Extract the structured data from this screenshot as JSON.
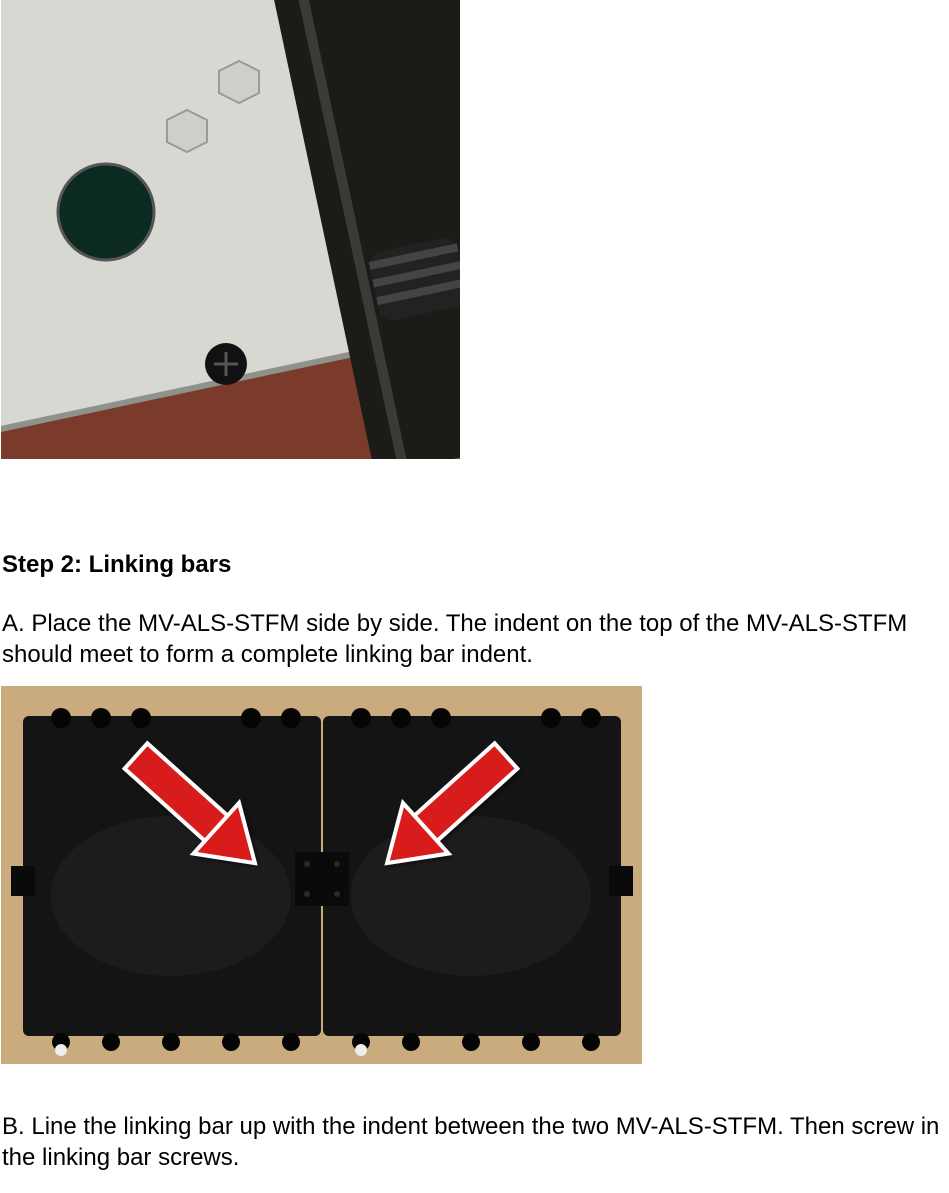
{
  "stepTitle": "Step 2: Linking bars",
  "paraA": "A. Place the MV-ALS-STFM side by side. The indent on the top of the MV-ALS-STFM should meet to form a complete linking bar indent.",
  "paraB": "B. Line the linking bar up with the indent between the two MV-ALS-STFM. Then screw in the linking bar screws."
}
